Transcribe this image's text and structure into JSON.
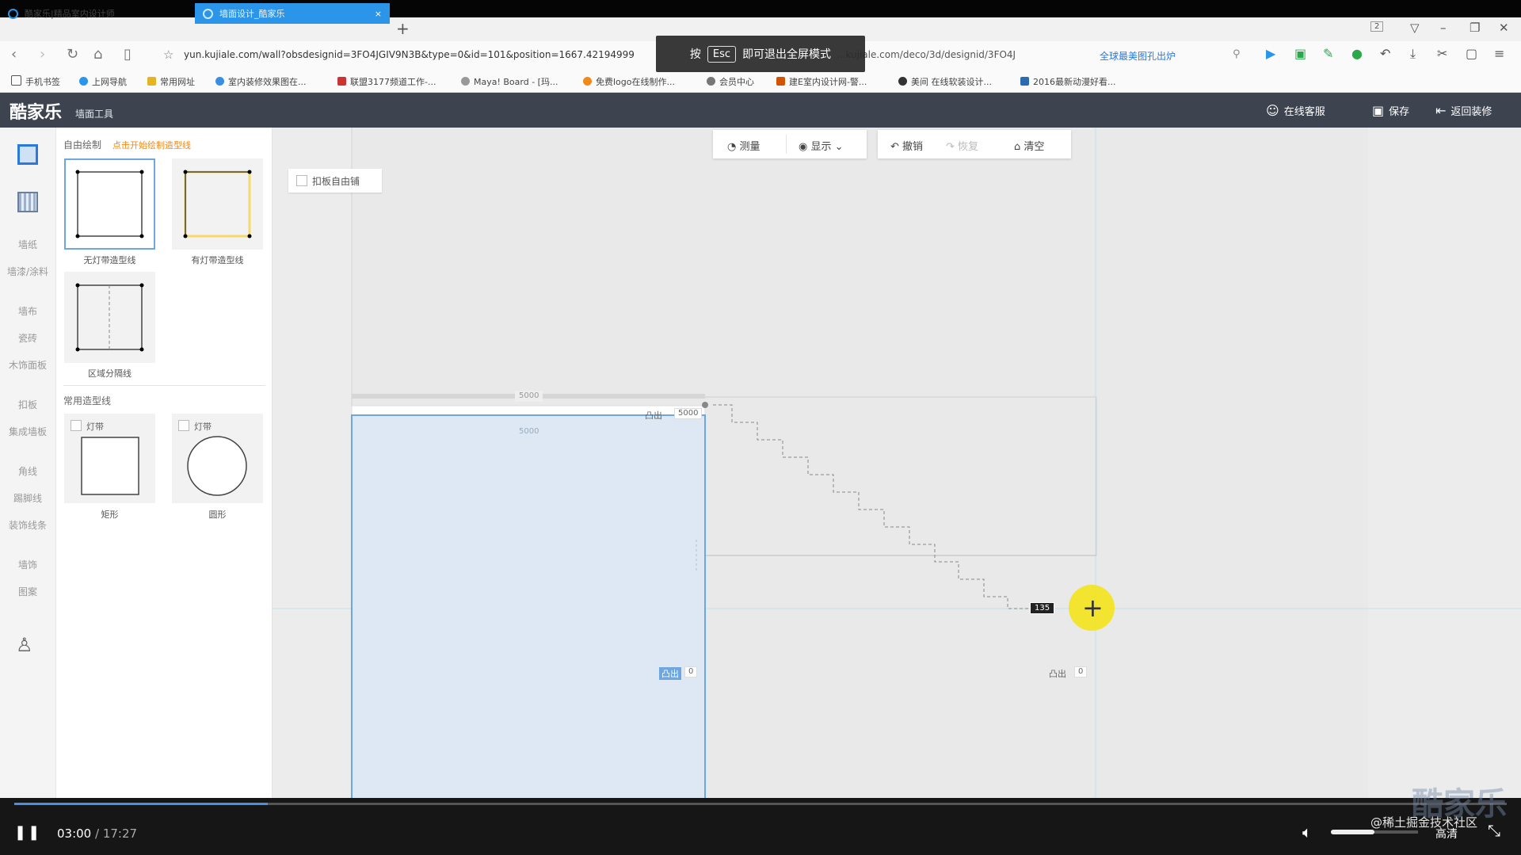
{
  "browser": {
    "tab1": "酷家乐|精品室内设计师",
    "tab2": "墙面设计_酷家乐",
    "tab_close": "×",
    "new_tab": "+",
    "tab_count": "2",
    "url": "yun.kujiale.com/wall?obsdesignid=3FO4JGIV9N3B&type=0&id=101&position=1667.42194999",
    "url_tail": "...kujiale.com/deco/3d/designid/3FO4J",
    "promo": "全球最美图孔出炉",
    "bookmarks": [
      "手机书签",
      "上网导航",
      "常用网址",
      "室内装修效果图在...",
      "联盟3177频道工作-...",
      "Maya! Board - [玛...",
      "免费logo在线制作...",
      "会员中心",
      "建E室内设计网-警...",
      "美间 在线软装设计...",
      "2016最新动漫好看..."
    ],
    "fullscreen_toast": {
      "prefix": "按",
      "key": "Esc",
      "suffix": "即可退出全屏模式"
    }
  },
  "app": {
    "logo": "酷家乐",
    "logo_sub": "墙面工具",
    "header_buttons": {
      "service": "在线客服",
      "save": "保存",
      "back": "返回装修"
    }
  },
  "sidebar": {
    "items": [
      "墙纸",
      "墙漆/涂料",
      "墙布",
      "瓷砖",
      "木饰面板",
      "扣板",
      "集成墙板",
      "角线",
      "踢脚线",
      "装饰线条",
      "墙饰",
      "图案"
    ]
  },
  "panel": {
    "free_draw_title": "自由绘制",
    "free_draw_hint": "点击开始绘制造型线",
    "tools": [
      "无灯带造型线",
      "有灯带造型线",
      "区域分隔线"
    ],
    "common_title": "常用造型线",
    "light_label": "灯带",
    "shapes": [
      "矩形",
      "圆形"
    ]
  },
  "canvas": {
    "toolbar": {
      "measure": "测量",
      "display": "显示",
      "undo": "撤销",
      "redo": "恢复",
      "clear": "清空"
    },
    "lock_label": "扣板自由铺",
    "top_strip": {
      "convex": "凸出",
      "value": "5000",
      "dim_top": "5000",
      "dim_bottom": "5000"
    },
    "rect_badge": {
      "convex": "凸出",
      "value": "0"
    },
    "wall_badge": {
      "convex": "凸出",
      "value": "0"
    },
    "cursor_tag": "135"
  },
  "player": {
    "current": "03:00",
    "total": "/ 17:27",
    "progress_fraction": 0.17,
    "volume_fraction": 0.5,
    "quality": "高清",
    "watermark": "@稀土掘金技术社区",
    "brand": "酷家乐"
  },
  "colors": {
    "accent": "#2b95e9",
    "header": "#3d4450",
    "selection_fill": "#dde8f4",
    "selection_stroke": "#6ea6e0",
    "cursor": "#f4e31b"
  }
}
